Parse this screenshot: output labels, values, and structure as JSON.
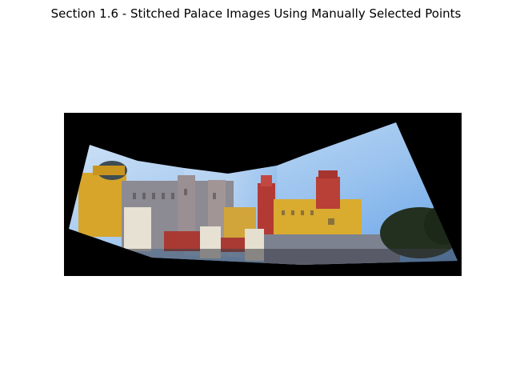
{
  "figure": {
    "title": "Section 1.6 - Stitched Palace Images Using Manually Selected Points"
  },
  "image": {
    "subject": "stitched panorama of a palace with yellow and red towers under blue sky",
    "colors": {
      "canvas": "#000000",
      "sky_light": "#cfe3f7",
      "sky_deep": "#6fa9e8",
      "yellow_wall": "#d7a52a",
      "red_wall": "#b33a34",
      "grey_wall": "#8c8a92",
      "white_battlement": "#e6e1d2",
      "dome": "#3f4c52",
      "trees": "#23301f"
    }
  }
}
